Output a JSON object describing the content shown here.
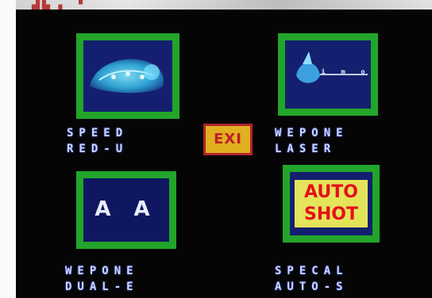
{
  "header": {
    "text": "▟▙ ▖ ▝"
  },
  "options": [
    {
      "id": "speed-up",
      "label_line1": "SPEED",
      "label_line2": "RED-U"
    },
    {
      "id": "weapon-laser",
      "label_line1": "WEPONE",
      "label_line2": "LASER"
    },
    {
      "id": "weapon-dual",
      "label_line1": "WEPONE",
      "label_line2": "DUAL-E"
    },
    {
      "id": "auto-shot",
      "label_line1": "SPECAL",
      "label_line2": "AUTO-S",
      "icon_text": "AUTO SHOT"
    }
  ],
  "dual_icon_glyphs": "A A",
  "laser_icon_glyphs": "ᵢ ₘ ₒ",
  "exit": {
    "label": "EXI"
  },
  "colors": {
    "frame_green": "#22a52a",
    "panel_blue": "#14206f",
    "label_blue": "#c8d6ff",
    "exit_yellow": "#e0b020",
    "exit_red": "#c01c28"
  },
  "icons": {
    "speed-up": "blob-ship-icon",
    "weapon-laser": "laser-ship-icon",
    "weapon-dual": "dual-ships-icon",
    "auto-shot": "auto-shot-sign-icon"
  }
}
